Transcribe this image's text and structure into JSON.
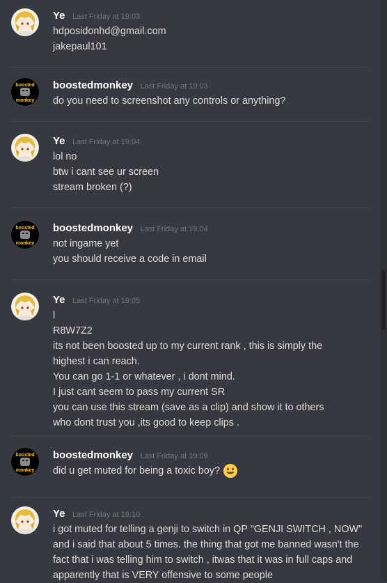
{
  "users": {
    "ye": "Ye",
    "boosted": "boostedmonkey"
  },
  "boosted_avatar_text": [
    "boosted",
    "monkey"
  ],
  "messages": [
    {
      "author": "Ye",
      "time": "Last Friday at 19:03",
      "lines": [
        "hdposidonhd@gmail.com",
        "jakepaul101"
      ]
    },
    {
      "author": "boostedmonkey",
      "time": "Last Friday at 19:03",
      "lines": [
        "do you need to screenshot any controls or anything?"
      ]
    },
    {
      "author": "Ye",
      "time": "Last Friday at 19:04",
      "lines": [
        "lol no",
        "btw i cant see ur screen",
        "stream broken (?)"
      ]
    },
    {
      "author": "boostedmonkey",
      "time": "Last Friday at 19:04",
      "lines": [
        "not ingame yet",
        "you should receive a code in email"
      ]
    },
    {
      "author": "Ye",
      "time": "Last Friday at 19:05",
      "lines": [
        "l",
        "R8W7Z2",
        "its not been boosted up to my current rank , this is simply the highest i can reach.",
        "You can go 1-1 or whatever , i dont mind.",
        "I just cant seem to pass my current SR",
        "you can use this stream (save as a clip) and show it to others who dont trust you ,its good to keep clips ."
      ]
    },
    {
      "author": "boostedmonkey",
      "time": "Last Friday at 19:09",
      "lines": [
        "did u get muted for being a toxic boy?"
      ],
      "emoji": "smiley-emoji"
    },
    {
      "author": "Ye",
      "time": "Last Friday at 19:10",
      "lines": [
        "i got muted for telling a genji to switch in QP \"GENJI SWITCH , NOW\" and i said that about 5 times. the thing that got me banned wasn't the fact that i was telling him to switch , itwas that it was in full caps and apparently that is VERY offensive to some people"
      ]
    }
  ]
}
